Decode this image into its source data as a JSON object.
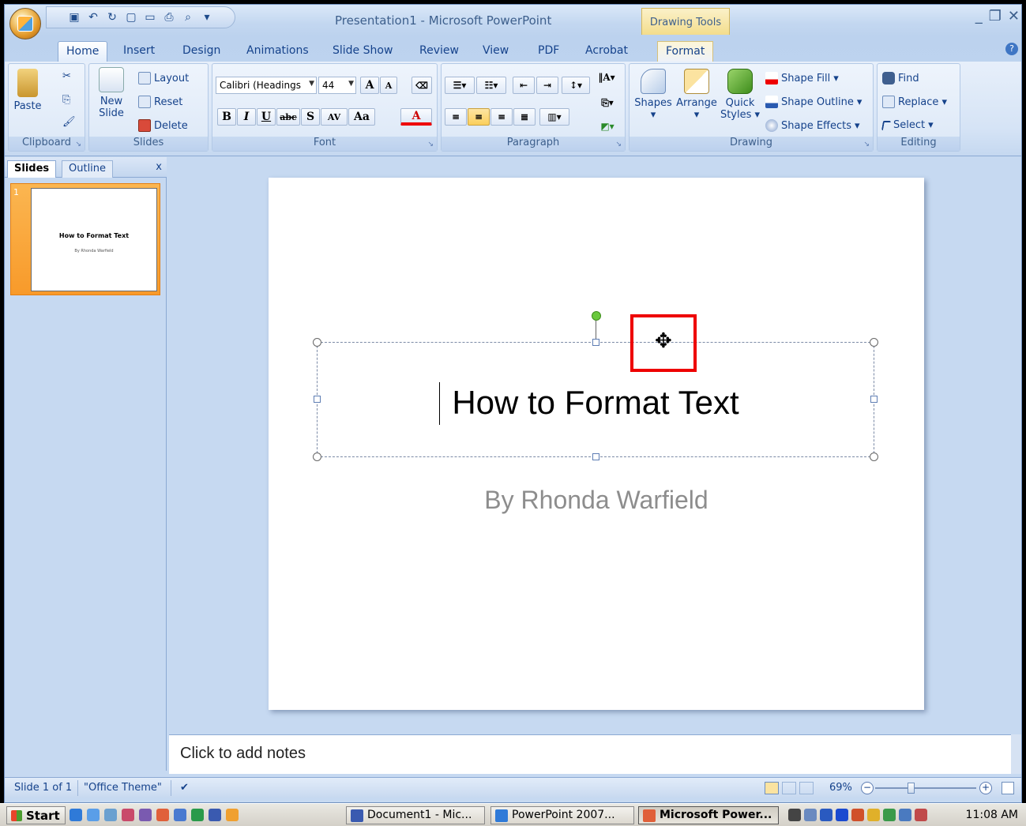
{
  "window": {
    "title": "Presentation1 - Microsoft PowerPoint",
    "context_group": "Drawing Tools"
  },
  "tabs": [
    "Home",
    "Insert",
    "Design",
    "Animations",
    "Slide Show",
    "Review",
    "View",
    "PDF",
    "Acrobat",
    "Format"
  ],
  "active_tab": "Home",
  "ribbon": {
    "clipboard": {
      "label": "Clipboard",
      "paste": "Paste"
    },
    "slides": {
      "label": "Slides",
      "new_slide_1": "New",
      "new_slide_2": "Slide",
      "layout": "Layout",
      "reset": "Reset",
      "delete": "Delete"
    },
    "font": {
      "label": "Font",
      "font_name": "Calibri (Headings",
      "font_size": "44",
      "bold": "B",
      "italic": "I",
      "underline": "U",
      "strike": "abc",
      "shadow": "S",
      "spacing": "AV",
      "case": "Aa",
      "color": "A"
    },
    "paragraph": {
      "label": "Paragraph"
    },
    "drawing": {
      "label": "Drawing",
      "shapes": "Shapes",
      "arrange": "Arrange",
      "quick_styles_1": "Quick",
      "quick_styles_2": "Styles",
      "shape_fill": "Shape Fill",
      "shape_outline": "Shape Outline",
      "shape_effects": "Shape Effects"
    },
    "editing": {
      "label": "Editing",
      "find": "Find",
      "replace": "Replace",
      "select": "Select"
    }
  },
  "left_pane": {
    "tab_slides": "Slides",
    "tab_outline": "Outline",
    "close": "x",
    "thumbnail": {
      "number": "1",
      "title": "How to Format Text",
      "subtitle": "By Rhonda Warfield"
    }
  },
  "slide": {
    "title": "How to Format Text",
    "subtitle": "By Rhonda Warfield"
  },
  "notes": {
    "placeholder": "Click to add notes"
  },
  "status": {
    "slide": "Slide 1 of 1",
    "theme": "\"Office Theme\"",
    "zoom": "69%"
  },
  "taskbar": {
    "start": "Start",
    "tasks": [
      "Document1 - Mic...",
      "PowerPoint 2007...",
      "Microsoft Power..."
    ],
    "active_task": "Microsoft Power...",
    "clock": "11:08 AM"
  },
  "colors": {
    "ribbon_blue": "#c6d9f1",
    "accent_orange": "#f89a2a",
    "highlight_red": "#e00000",
    "handle_green": "#6ac93d"
  }
}
